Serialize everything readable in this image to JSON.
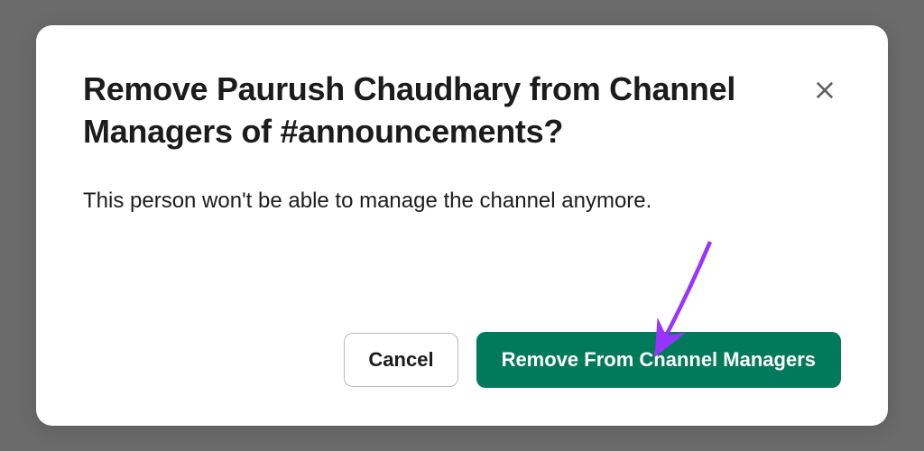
{
  "modal": {
    "title": "Remove Paurush Chaudhary from Channel Managers of #announcements?",
    "body": "This person won't be able to manage the channel anymore.",
    "cancel_label": "Cancel",
    "confirm_label": "Remove From Channel Managers"
  }
}
